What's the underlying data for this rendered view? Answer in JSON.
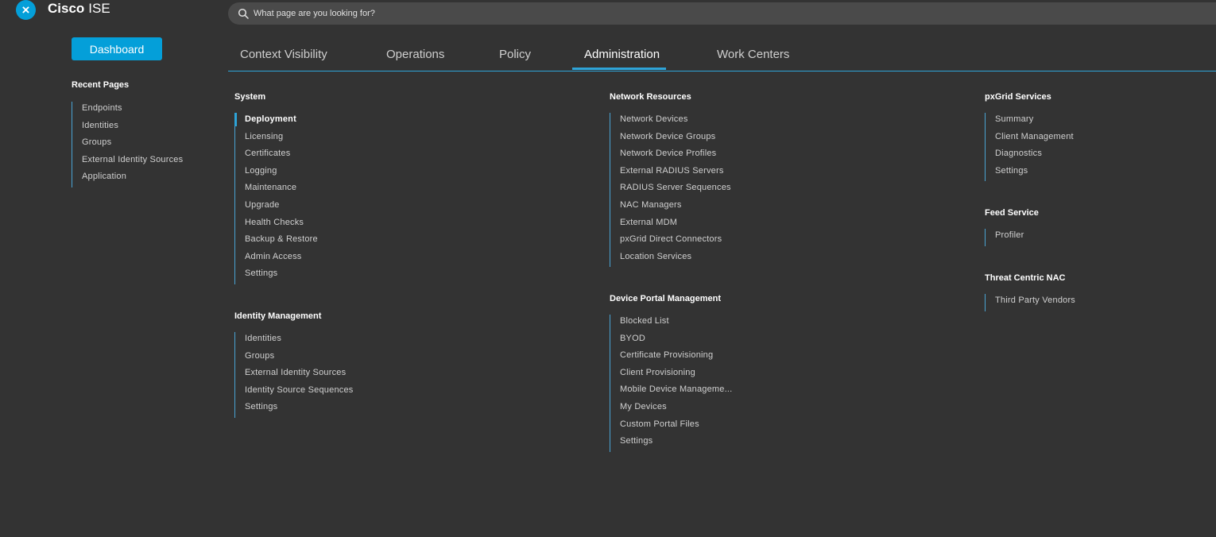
{
  "header": {
    "brand_bold": "Cisco",
    "brand_light": "ISE",
    "close_icon": "×",
    "search_placeholder": "What page are you looking for?"
  },
  "sidebar": {
    "dashboard_label": "Dashboard",
    "recent_title": "Recent Pages",
    "recent_items": [
      "Endpoints",
      "Identities",
      "Groups",
      "External Identity Sources",
      "Application"
    ]
  },
  "tabs": [
    "Context Visibility",
    "Operations",
    "Policy",
    "Administration",
    "Work Centers"
  ],
  "active_tab": "Administration",
  "accent_color": "#049fd9",
  "menu": {
    "system": {
      "title": "System",
      "items": [
        "Deployment",
        "Licensing",
        "Certificates",
        "Logging",
        "Maintenance",
        "Upgrade",
        "Health Checks",
        "Backup & Restore",
        "Admin Access",
        "Settings"
      ]
    },
    "identity_management": {
      "title": "Identity Management",
      "items": [
        "Identities",
        "Groups",
        "External Identity Sources",
        "Identity Source Sequences",
        "Settings"
      ]
    },
    "network_resources": {
      "title": "Network Resources",
      "items": [
        "Network Devices",
        "Network Device Groups",
        "Network Device Profiles",
        "External RADIUS Servers",
        "RADIUS Server Sequences",
        "NAC Managers",
        "External MDM",
        "pxGrid Direct Connectors",
        "Location Services"
      ]
    },
    "device_portal_management": {
      "title": "Device Portal Management",
      "items": [
        "Blocked List",
        "BYOD",
        "Certificate Provisioning",
        "Client Provisioning",
        "Mobile Device Manageme...",
        "My Devices",
        "Custom Portal Files",
        "Settings"
      ]
    },
    "pxgrid_services": {
      "title": "pxGrid Services",
      "items": [
        "Summary",
        "Client Management",
        "Diagnostics",
        "Settings"
      ]
    },
    "feed_service": {
      "title": "Feed Service",
      "items": [
        "Profiler"
      ]
    },
    "threat_centric_nac": {
      "title": "Threat Centric NAC",
      "items": [
        "Third Party Vendors"
      ]
    }
  }
}
